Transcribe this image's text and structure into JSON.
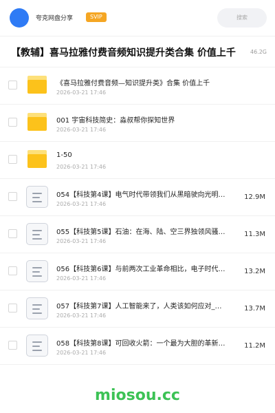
{
  "header": {
    "user_name": "夸克网盘分享",
    "badge": "SVIP",
    "search_placeholder": "搜索"
  },
  "share": {
    "title": "【教辅】喜马拉雅付费音频知识提升类合集 价值上千",
    "total_size": "46.2G"
  },
  "files": [
    {
      "type": "folder",
      "name": "《喜马拉雅付费音频—知识提升类》合集 价值上千",
      "date": "2026-03-21 17:46",
      "size": ""
    },
    {
      "type": "folder",
      "name": "001 宇宙科技简史：淼叔帮你探知世界",
      "date": "2026-03-21 17:46",
      "size": ""
    },
    {
      "type": "folder",
      "name": "1-50",
      "date": "2026-03-21 17:46",
      "size": ""
    },
    {
      "type": "file",
      "name": "054【科技第4课】电气时代带领我们从黑暗驶向光明…",
      "date": "2026-03-21 17:46",
      "size": "12.9M"
    },
    {
      "type": "file",
      "name": "055【科技第5课】石油：在海、陆、空三界独领风骚…",
      "date": "2026-03-21 17:46",
      "size": "11.3M"
    },
    {
      "type": "file",
      "name": "056【科技第6课】与前两次工业革命相比，电子时代…",
      "date": "2026-03-21 17:46",
      "size": "13.2M"
    },
    {
      "type": "file",
      "name": "057【科技第7课】人工智能来了，人类该如何应对_…",
      "date": "2026-03-21 17:46",
      "size": "13.7M"
    },
    {
      "type": "file",
      "name": "058【科技第8课】可回收火箭：一个最为大胆的革新…",
      "date": "2026-03-21 17:46",
      "size": "11.2M"
    }
  ],
  "watermark": "miosou.cc",
  "colors": {
    "avatar": "#2f7bf5",
    "svip_badge": "#f5a623",
    "folder": "#fcc21b",
    "watermark": "#3cc255"
  }
}
